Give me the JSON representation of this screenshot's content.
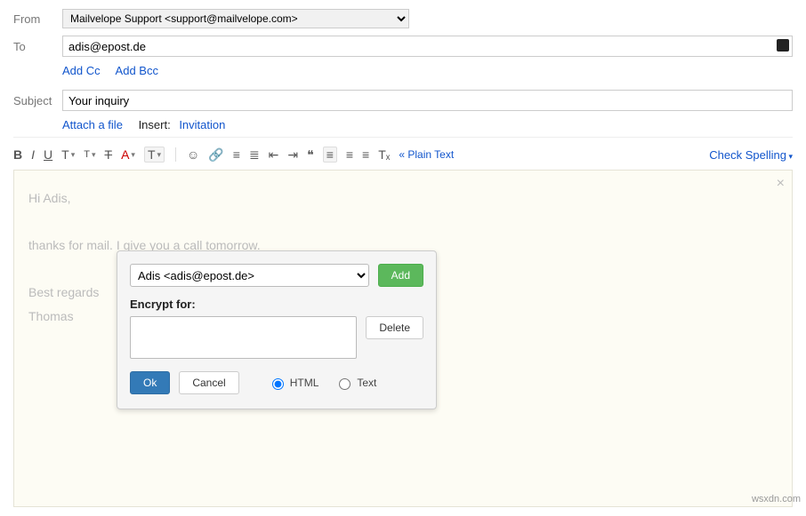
{
  "labels": {
    "from": "From",
    "to": "To",
    "subject": "Subject"
  },
  "from": {
    "selected": "Mailvelope Support <support@mailvelope.com>"
  },
  "to": {
    "value": "adis@epost.de"
  },
  "cc_links": {
    "add_cc": "Add Cc",
    "add_bcc": "Add Bcc"
  },
  "subject": {
    "value": "Your inquiry"
  },
  "attach_row": {
    "attach": "Attach a file",
    "insert": "Insert:",
    "invitation": "Invitation"
  },
  "toolbar": {
    "bold": "B",
    "italic": "I",
    "underline": "U",
    "fontfamily": "T",
    "fontsize": "T",
    "strike": "T",
    "textcolor": "A",
    "highlight": "T",
    "emoji": "☺",
    "link": "🔗",
    "ol": "≡",
    "ul": "≣",
    "outdent": "⇤",
    "indent": "⇥",
    "quote": "❝",
    "align_l": "≡",
    "align_c": "≡",
    "align_r": "≡",
    "clear": "Tₓ",
    "plain_text": "Plain Text",
    "spelling": "Check Spelling"
  },
  "body": "Hi Adis,\n\nthanks for mail. I give you a call tomorrow.\n\nBest regards\nThomas",
  "popup": {
    "recipient_selected": "Adis <adis@epost.de>",
    "add": "Add",
    "encrypt_for": "Encrypt for:",
    "delete": "Delete",
    "ok": "Ok",
    "cancel": "Cancel",
    "radio_html": "HTML",
    "radio_text": "Text"
  },
  "watermark": "wsxdn.com"
}
